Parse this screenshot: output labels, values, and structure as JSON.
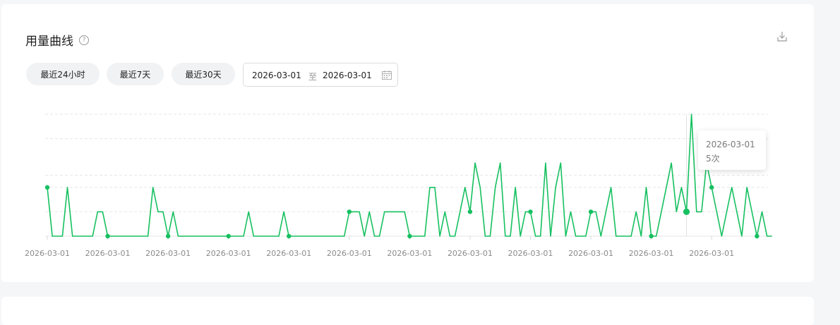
{
  "header": {
    "title": "用量曲线",
    "help_glyph": "?"
  },
  "filters": {
    "btn_24h": "最近24小时",
    "btn_7d": "最近7天",
    "btn_30d": "最近30天",
    "date_start": "2026-03-01",
    "date_separator": "至",
    "date_end": "2026-03-01"
  },
  "tooltip": {
    "date": "2026-03-01",
    "value": "5次"
  },
  "colors": {
    "line": "#16c060",
    "grid": "#e6e6e6"
  },
  "chart_data": {
    "type": "line",
    "title": "",
    "xlabel": "",
    "ylabel": "",
    "ylim": [
      0,
      5
    ],
    "grid": "horizontal dashed",
    "x_tick_labels": [
      "2026-03-01",
      "2026-03-01",
      "2026-03-01",
      "2026-03-01",
      "2026-03-01",
      "2026-03-01",
      "2026-03-01",
      "2026-03-01",
      "2026-03-01",
      "2026-03-01",
      "2026-03-01",
      "2026-03-01"
    ],
    "marker_indices": [
      0,
      12,
      24,
      36,
      48,
      60,
      72,
      84,
      96,
      108,
      120,
      132,
      141
    ],
    "highlight_index": 127,
    "series": [
      {
        "values": [
          2,
          0,
          0,
          0,
          2,
          0,
          0,
          0,
          0,
          0,
          1,
          1,
          0,
          0,
          0,
          0,
          0,
          0,
          0,
          0,
          0,
          2,
          1,
          1,
          0,
          1,
          0,
          0,
          0,
          0,
          0,
          0,
          0,
          0,
          0,
          0,
          0,
          0,
          0,
          0,
          1,
          0,
          0,
          0,
          0,
          0,
          0,
          1,
          0,
          0,
          0,
          0,
          0,
          0,
          0,
          0,
          0,
          0,
          0,
          0,
          1,
          1,
          1,
          0,
          1,
          0,
          0,
          1,
          1,
          1,
          1,
          1,
          0,
          0,
          0,
          0,
          2,
          2,
          0,
          1,
          0,
          0,
          1,
          2,
          1,
          3,
          2,
          0,
          0,
          2,
          3,
          0,
          0,
          2,
          0,
          1,
          1,
          0,
          0,
          3,
          0,
          2,
          3,
          0,
          1,
          0,
          0,
          0,
          1,
          1,
          0,
          1,
          2,
          0,
          0,
          0,
          0,
          1,
          0,
          2,
          0,
          0,
          1,
          2,
          3,
          1,
          2,
          1,
          5,
          1,
          1,
          3,
          2,
          1,
          0,
          1,
          2,
          1,
          0,
          2,
          1,
          0,
          1,
          0,
          0
        ]
      }
    ]
  }
}
